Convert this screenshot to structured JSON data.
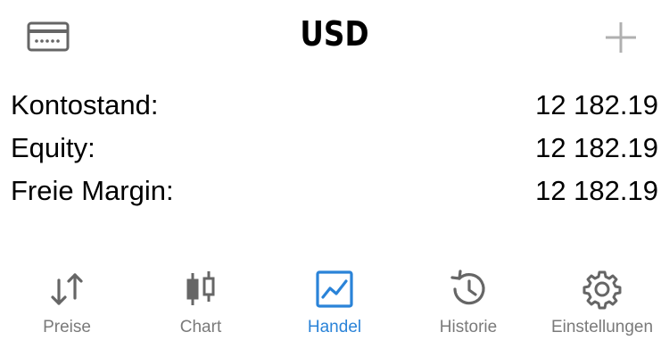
{
  "header": {
    "title": "USD",
    "accounts_icon": "card-icon",
    "add_icon": "plus-icon"
  },
  "balances": [
    {
      "label": "Kontostand:",
      "value": "12 182.19"
    },
    {
      "label": "Equity:",
      "value": "12 182.19"
    },
    {
      "label": "Freie Margin:",
      "value": "12 182.19"
    }
  ],
  "tabbar": {
    "tabs": [
      {
        "label": "Preise",
        "icon": "arrows-up-down-icon",
        "active": false
      },
      {
        "label": "Chart",
        "icon": "candlestick-icon",
        "active": false
      },
      {
        "label": "Handel",
        "icon": "trade-chart-icon",
        "active": true
      },
      {
        "label": "Historie",
        "icon": "history-icon",
        "active": false
      },
      {
        "label": "Einstellungen",
        "icon": "gear-icon",
        "active": false
      }
    ]
  },
  "colors": {
    "active": "#2a83d8",
    "inactive": "#7a7a7a",
    "icon_gray": "#666666"
  }
}
